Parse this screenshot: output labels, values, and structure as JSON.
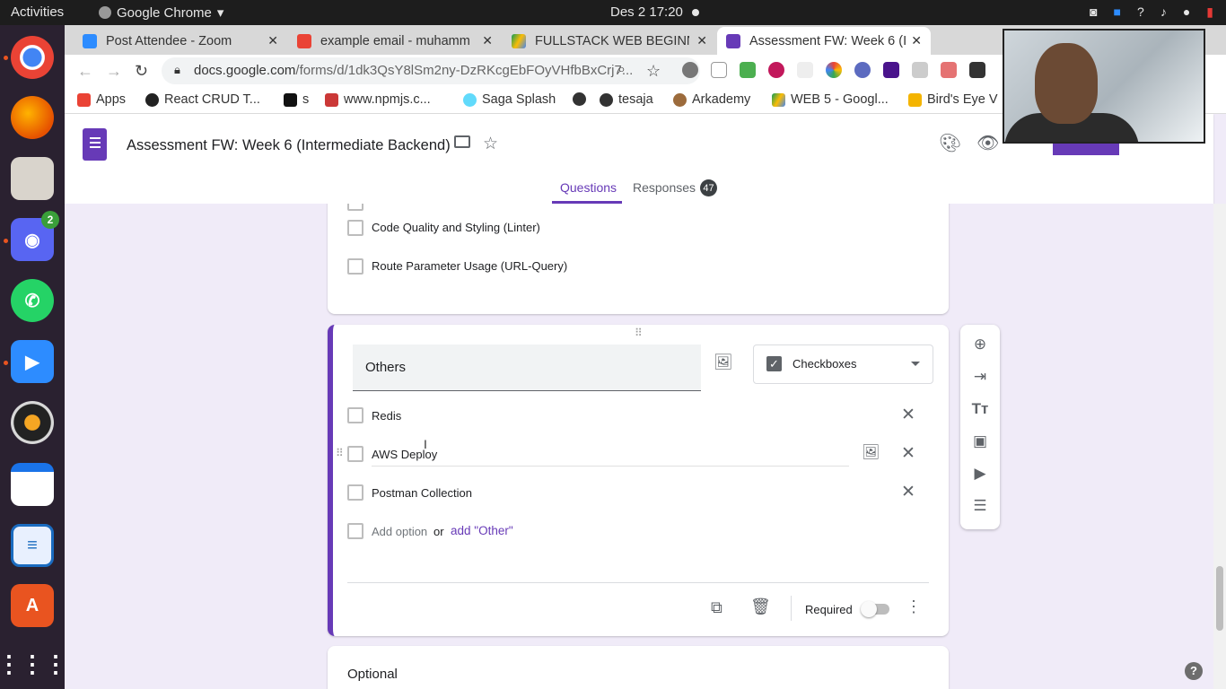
{
  "system_bar": {
    "activities": "Activities",
    "app_name": "Google Chrome",
    "clock": "Des 2  17:20"
  },
  "dock": {
    "items": [
      {
        "name": "chrome-icon"
      },
      {
        "name": "firefox-icon"
      },
      {
        "name": "files-icon"
      },
      {
        "name": "discord-icon",
        "badge": "2"
      },
      {
        "name": "whatsapp-icon"
      },
      {
        "name": "zoom-icon"
      },
      {
        "name": "rhythmbox-icon"
      },
      {
        "name": "writer-icon"
      },
      {
        "name": "libreoffice-icon"
      },
      {
        "name": "software-icon"
      },
      {
        "name": "apps-grid-icon"
      }
    ]
  },
  "browser": {
    "tabs": [
      {
        "title": "Post Attendee - Zoom",
        "color": "#2d8cff"
      },
      {
        "title": "example email - muhamm",
        "color": "#ea4335"
      },
      {
        "title": "FULLSTACK WEB BEGINNI",
        "color": "#fbbc04"
      },
      {
        "title": "Assessment FW: Week 6 (I",
        "color": "#673ab7"
      }
    ],
    "url_host": "docs.google.com",
    "url_path": "/forms/d/1dk3QsY8lSm2ny-DzRKcgEbFOyVHfbBxCrj7...",
    "bookmarks": [
      {
        "label": "Apps",
        "color": "#ea4335"
      },
      {
        "label": "React CRUD T...",
        "color": "#222222"
      },
      {
        "label": "s",
        "color": "#111111"
      },
      {
        "label": "www.npmjs.c...",
        "color": "#cb3837"
      },
      {
        "label": "Saga Splash",
        "color": "#61dafb"
      },
      {
        "label": "",
        "color": "#333333"
      },
      {
        "label": "tesaja",
        "color": "#333333"
      },
      {
        "label": "Arkademy",
        "color": "#9c6b3c"
      },
      {
        "label": "WEB 5 - Googl...",
        "color": "#fbbc04"
      },
      {
        "label": "Bird's Eye V",
        "color": "#f4b400"
      }
    ]
  },
  "form": {
    "title": "Assessment FW: Week 6 (Intermediate Backend)",
    "tabs": {
      "questions": "Questions",
      "responses": "Responses",
      "responses_count": "47"
    },
    "prev_card": {
      "options": [
        "Code Quality and Styling (Linter)",
        "Route Parameter Usage (URL-Query)"
      ]
    },
    "active_card": {
      "question": "Others",
      "type": "Checkboxes",
      "options": [
        "Redis",
        "AWS Deploy",
        "Postman Collection"
      ],
      "add_option": "Add option",
      "or": "or",
      "add_other": "add \"Other\"",
      "required_label": "Required",
      "required": false
    },
    "next_card": {
      "title": "Optional"
    }
  },
  "accent_color": "#673ab7"
}
